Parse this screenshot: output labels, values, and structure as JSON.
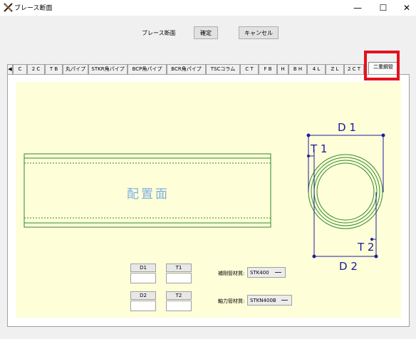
{
  "window": {
    "title": "ブレース断面",
    "icon": "app-x-icon",
    "minimize_icon": "minimize-icon",
    "maximize_icon": "maximize-icon",
    "close_icon": "close-icon",
    "minimize_glyph": "—",
    "maximize_glyph": "☐",
    "close_glyph": "✕"
  },
  "header": {
    "label": "ブレース断面",
    "ok_button": "確定",
    "cancel_button": "キャンセル"
  },
  "tabs": [
    {
      "label": "◀"
    },
    {
      "label": "C"
    },
    {
      "label": "2 C"
    },
    {
      "label": "T B"
    },
    {
      "label": "丸パイプ"
    },
    {
      "label": "STKR角パイプ"
    },
    {
      "label": "BCP角パイプ"
    },
    {
      "label": "BCR角パイプ"
    },
    {
      "label": "TSCコラム"
    },
    {
      "label": "C T"
    },
    {
      "label": "F B"
    },
    {
      "label": "H"
    },
    {
      "label": "B H"
    },
    {
      "label": "4 L"
    },
    {
      "label": "Z L"
    },
    {
      "label": "2 C T"
    },
    {
      "label": "二重鋼管"
    }
  ],
  "active_tab": "二重鋼管",
  "drawing": {
    "placement_label": "配置面",
    "dim_d1": "D 1",
    "dim_t1": "T 1",
    "dim_d2": "D 2",
    "dim_t2": "T 2",
    "line_color": "#2f8a2f",
    "dim_color": "#1f1f9f",
    "placement_color": "#7fb0e0"
  },
  "fields": {
    "d1": {
      "label": "D1",
      "value": ""
    },
    "t1": {
      "label": "T1",
      "value": ""
    },
    "d2": {
      "label": "D2",
      "value": ""
    },
    "t2": {
      "label": "T2",
      "value": ""
    }
  },
  "materials": {
    "reinforcement_label": "補剛管材質:",
    "reinforcement_value": "STK400",
    "axial_label": "軸力管材質:",
    "axial_value": "STKN400B"
  },
  "colors": {
    "highlight": "#e3121d",
    "canvas_bg": "#fefed8"
  }
}
